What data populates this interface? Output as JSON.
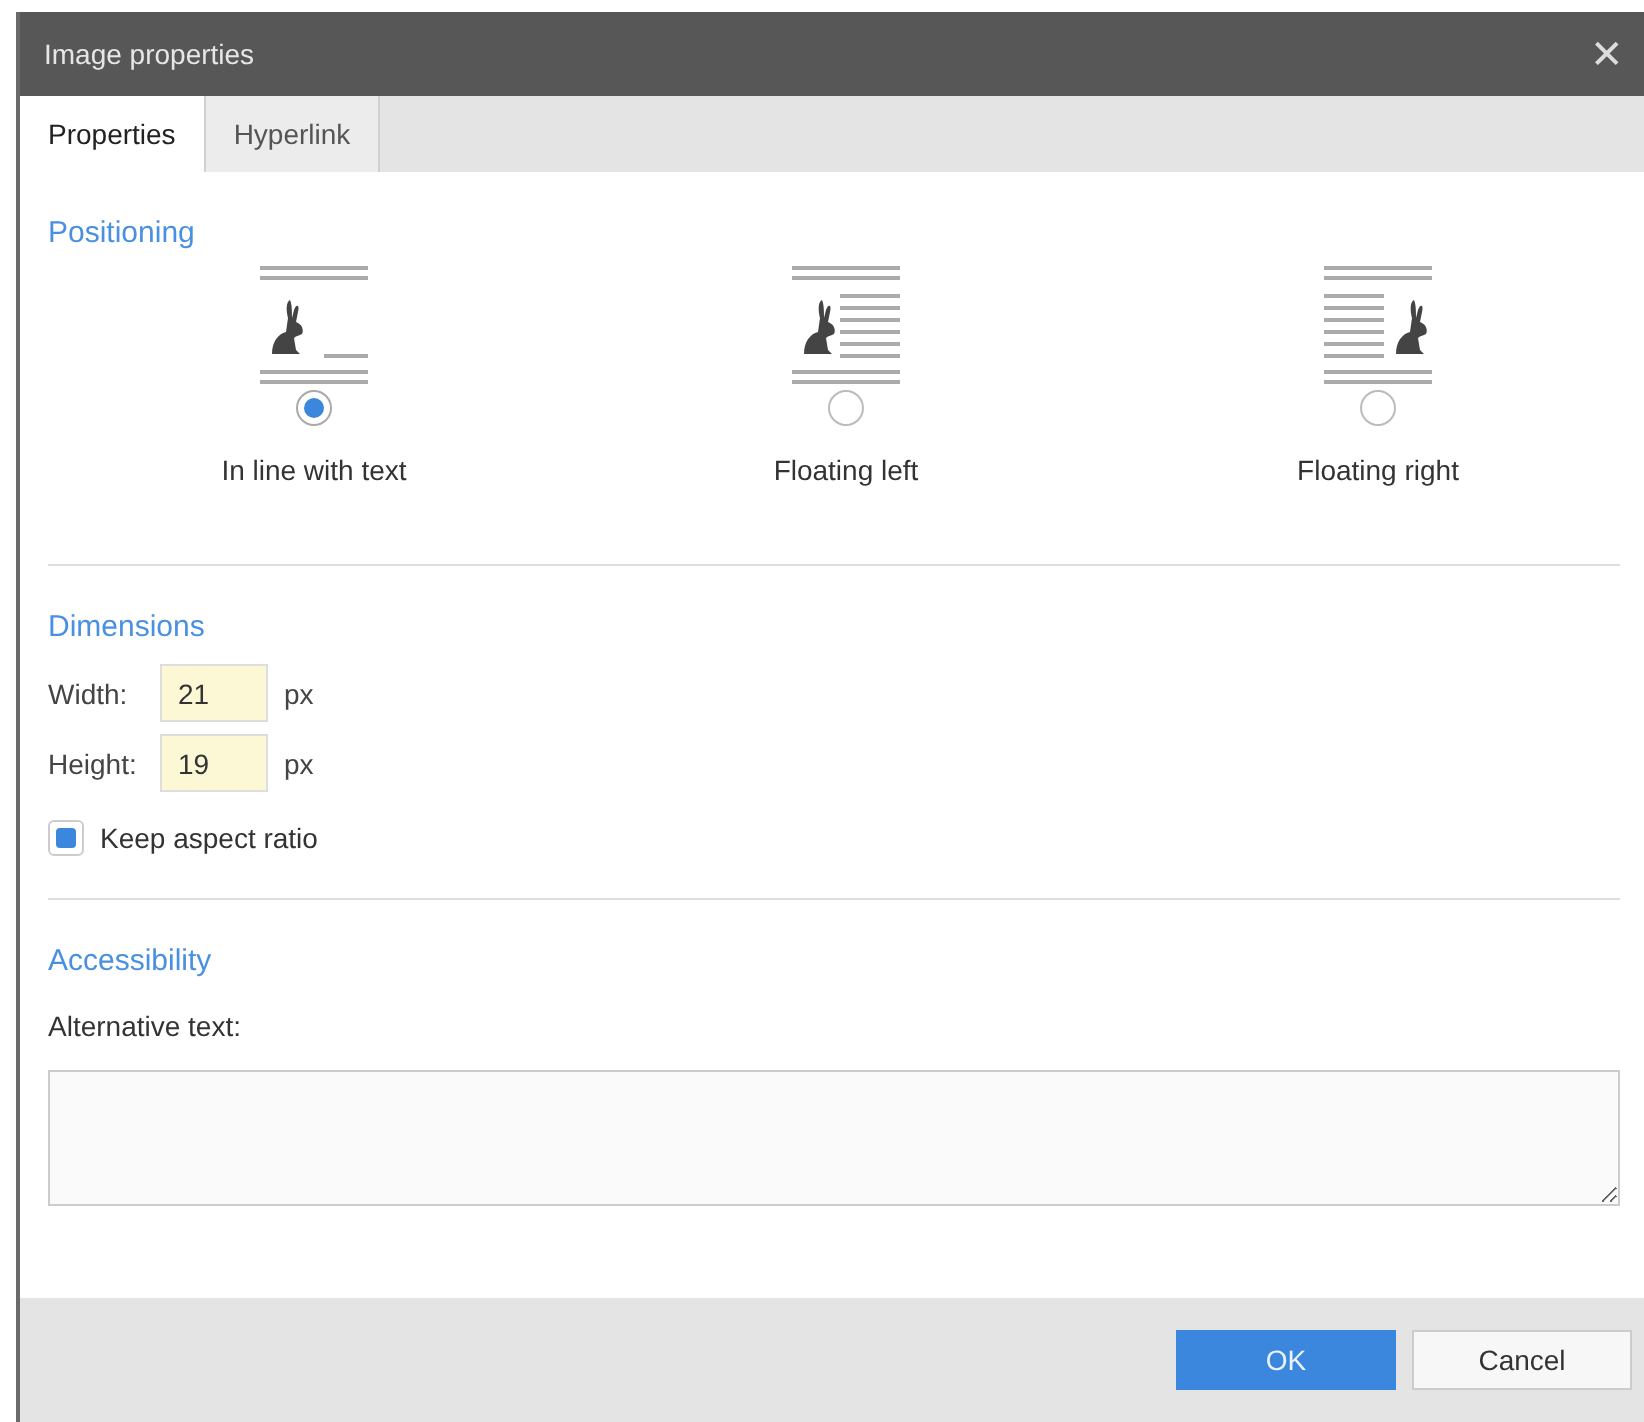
{
  "window": {
    "title": "Image properties",
    "close": "✕"
  },
  "tabs": [
    {
      "label": "Properties",
      "selected": true
    },
    {
      "label": "Hyperlink",
      "selected": false
    }
  ],
  "positioning": {
    "heading": "Positioning",
    "options": [
      {
        "kind": "inline",
        "label": "In line with text",
        "selected": true
      },
      {
        "kind": "float-left",
        "label": "Floating left",
        "selected": false
      },
      {
        "kind": "float-right",
        "label": "Floating right",
        "selected": false
      }
    ]
  },
  "dimensions": {
    "heading": "Dimensions",
    "fields": [
      {
        "label": "Width:",
        "value": "21",
        "unit": "px"
      },
      {
        "label": "Height:",
        "value": "19",
        "unit": "px"
      }
    ],
    "keep_ratio": {
      "label": "Keep aspect ratio",
      "checked": true
    }
  },
  "accessibility": {
    "heading": "Accessibility",
    "alt_label": "Alternative text:"
  },
  "buttons": [
    {
      "label": "OK",
      "kind": "primary"
    },
    {
      "label": "Cancel",
      "kind": "secondary"
    }
  ]
}
